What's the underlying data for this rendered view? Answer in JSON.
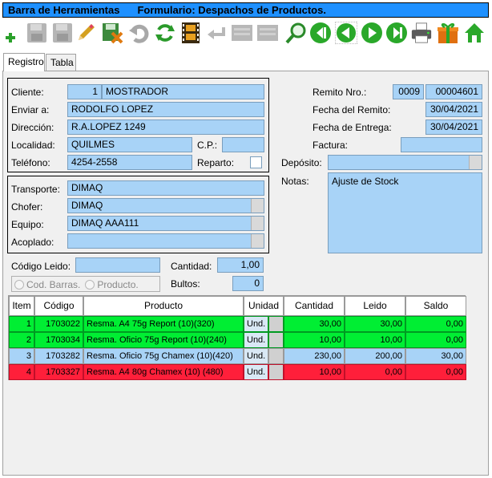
{
  "window": {
    "title_left": "Barra de Herramientas",
    "title_right": "Formulario: Despachos de Productos."
  },
  "toolbar": {
    "buttons": [
      "add-icon",
      "save-icon",
      "save-disabled-icon",
      "edit-icon",
      "delete-icon",
      "undo-icon",
      "refresh-icon",
      "film-icon",
      "return-icon",
      "list-icon",
      "list2-icon",
      "search-icon",
      "first-icon",
      "prev-icon",
      "next-icon",
      "last-icon",
      "print-icon",
      "gift-icon",
      "home-icon"
    ]
  },
  "tabs": [
    {
      "label": "Registro"
    },
    {
      "label": "Tabla"
    }
  ],
  "form": {
    "cliente_label": "Cliente:",
    "cliente_code": "1",
    "cliente_name": "MOSTRADOR",
    "enviar_label": "Enviar a:",
    "enviar_value": "RODOLFO LOPEZ",
    "direccion_label": "Dirección:",
    "direccion_value": "R.A.LOPEZ 1249",
    "localidad_label": "Localidad:",
    "localidad_value": "QUILMES",
    "cp_label": "C.P.:",
    "cp_value": "",
    "telefono_label": "Teléfono:",
    "telefono_value": "4254-2558",
    "reparto_label": "Reparto:",
    "remito_label": "Remito Nro.:",
    "remito_prefix": "0009",
    "remito_number": "00004601",
    "fecha_remito_label": "Fecha del Remito:",
    "fecha_remito_value": "30/04/2021",
    "fecha_entrega_label": "Fecha de Entrega:",
    "fecha_entrega_value": "30/04/2021",
    "factura_label": "Factura:",
    "factura_value": "",
    "deposito_label": "Depósito:",
    "deposito_value": "",
    "notas_label": "Notas:",
    "notas_value": "Ajuste de Stock",
    "transporte_label": "Transporte:",
    "transporte_value": "DIMAQ",
    "chofer_label": "Chofer:",
    "chofer_value": "DIMAQ",
    "equipo_label": "Equipo:",
    "equipo_value": "DIMAQ AAA111",
    "acoplado_label": "Acoplado:",
    "acoplado_value": "",
    "codigo_leido_label": "Código Leido:",
    "codigo_leido_value": "",
    "cantidad_label": "Cantidad:",
    "cantidad_value": "1,00",
    "bultos_label": "Bultos:",
    "bultos_value": "0",
    "radio_barras": "Cod. Barras.",
    "radio_producto": "Producto."
  },
  "grid": {
    "headers": [
      "Item",
      "Código",
      "Producto",
      "Unidad",
      "Cantidad",
      "Leido",
      "Saldo"
    ],
    "rows": [
      {
        "status": "green",
        "item": "1",
        "codigo": "1703022",
        "producto": "Resma. A4 75g Report (10)(320)",
        "unidad": "Und.",
        "cantidad": "30,00",
        "leido": "30,00",
        "saldo": "0,00"
      },
      {
        "status": "green",
        "item": "2",
        "codigo": "1703034",
        "producto": "Resma. Oficio 75g Report (10)(240)",
        "unidad": "Und.",
        "cantidad": "10,00",
        "leido": "10,00",
        "saldo": "0,00"
      },
      {
        "status": "blue",
        "item": "3",
        "codigo": "1703282",
        "producto": "Resma. Oficio 75g Chamex (10)(420)",
        "unidad": "Und.",
        "cantidad": "230,00",
        "leido": "200,00",
        "saldo": "30,00"
      },
      {
        "status": "red",
        "item": "4",
        "codigo": "1703327",
        "producto": "Resma. A4 80g Chamex (10) (480)",
        "unidad": "Und.",
        "cantidad": "10,00",
        "leido": "0,00",
        "saldo": "0,00"
      }
    ]
  },
  "colors": {
    "title_bg": "#1e90ff",
    "field_bg": "#a8d3f7",
    "row_green": "#00ee33",
    "row_blue": "#a8d3f7",
    "row_red": "#ff1f3a"
  }
}
